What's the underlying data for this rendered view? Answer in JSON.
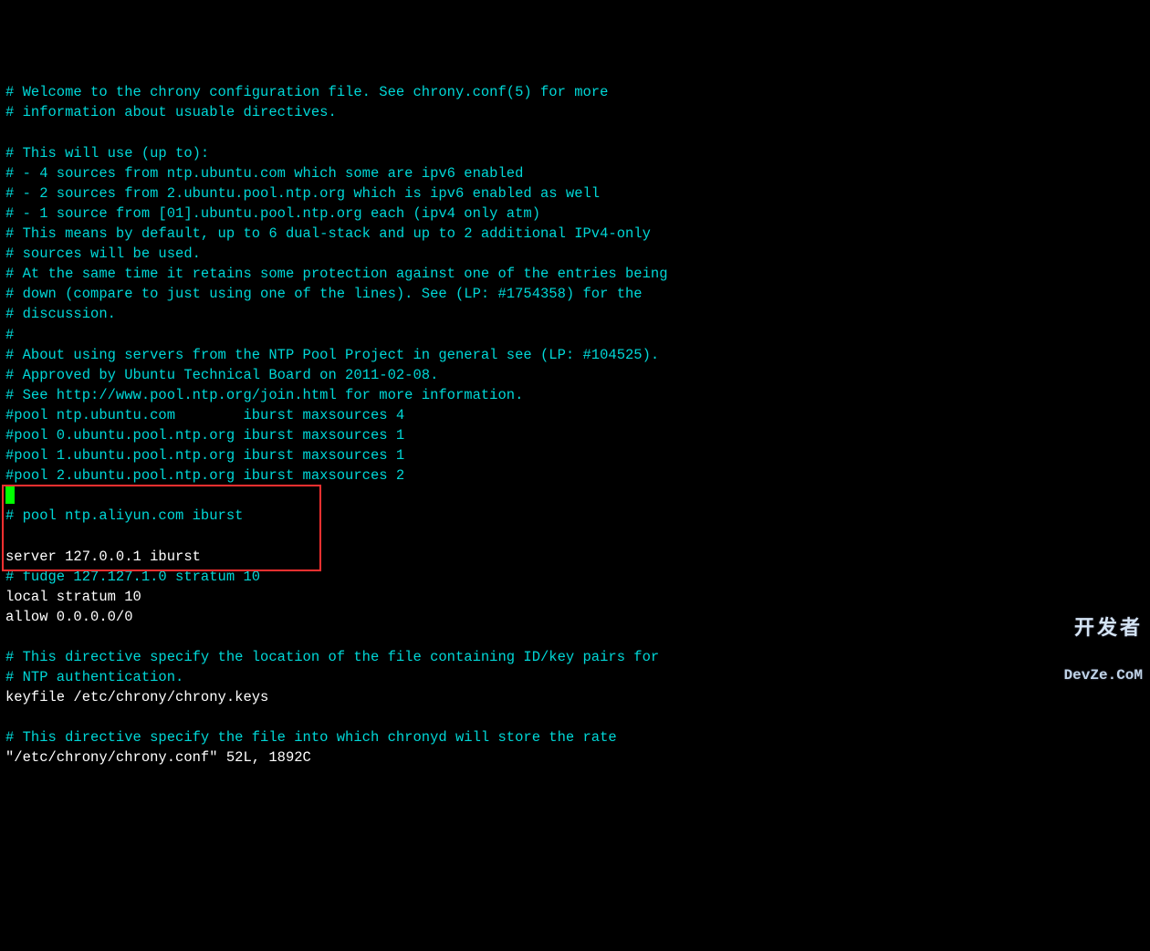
{
  "lines": [
    {
      "text": "# Welcome to the chrony configuration file. See chrony.conf(5) for more",
      "class": "c-cyan"
    },
    {
      "text": "# information about usuable directives.",
      "class": "c-cyan"
    },
    {
      "text": "",
      "class": "c-white"
    },
    {
      "text": "# This will use (up to):",
      "class": "c-cyan"
    },
    {
      "text": "# - 4 sources from ntp.ubuntu.com which some are ipv6 enabled",
      "class": "c-cyan"
    },
    {
      "text": "# - 2 sources from 2.ubuntu.pool.ntp.org which is ipv6 enabled as well",
      "class": "c-cyan"
    },
    {
      "text": "# - 1 source from [01].ubuntu.pool.ntp.org each (ipv4 only atm)",
      "class": "c-cyan"
    },
    {
      "text": "# This means by default, up to 6 dual-stack and up to 2 additional IPv4-only",
      "class": "c-cyan"
    },
    {
      "text": "# sources will be used.",
      "class": "c-cyan"
    },
    {
      "text": "# At the same time it retains some protection against one of the entries being",
      "class": "c-cyan"
    },
    {
      "text": "# down (compare to just using one of the lines). See (LP: #1754358) for the",
      "class": "c-cyan"
    },
    {
      "text": "# discussion.",
      "class": "c-cyan"
    },
    {
      "text": "#",
      "class": "c-cyan"
    },
    {
      "text": "# About using servers from the NTP Pool Project in general see (LP: #104525).",
      "class": "c-cyan"
    },
    {
      "text": "# Approved by Ubuntu Technical Board on 2011-02-08.",
      "class": "c-cyan"
    },
    {
      "text": "# See http://www.pool.ntp.org/join.html for more information.",
      "class": "c-cyan"
    },
    {
      "text": "#pool ntp.ubuntu.com        iburst maxsources 4",
      "class": "c-cyan"
    },
    {
      "text": "#pool 0.ubuntu.pool.ntp.org iburst maxsources 1",
      "class": "c-cyan"
    },
    {
      "text": "#pool 1.ubuntu.pool.ntp.org iburst maxsources 1",
      "class": "c-cyan"
    },
    {
      "text": "#pool 2.ubuntu.pool.ntp.org iburst maxsources 2",
      "class": "c-cyan"
    },
    {
      "cursor": true
    },
    {
      "text": "# pool ntp.aliyun.com iburst",
      "class": "c-cyan"
    },
    {
      "text": "",
      "class": "c-white"
    },
    {
      "text": "server 127.0.0.1 iburst",
      "class": "c-white"
    },
    {
      "text": "# fudge 127.127.1.0 stratum 10",
      "class": "c-cyan"
    },
    {
      "text": "local stratum 10",
      "class": "c-white"
    },
    {
      "text": "allow 0.0.0.0/0",
      "class": "c-white"
    },
    {
      "text": "",
      "class": "c-white"
    },
    {
      "text": "# This directive specify the location of the file containing ID/key pairs for",
      "class": "c-cyan"
    },
    {
      "text": "# NTP authentication.",
      "class": "c-cyan"
    },
    {
      "text": "keyfile /etc/chrony/chrony.keys",
      "class": "c-white"
    },
    {
      "text": "",
      "class": "c-white"
    },
    {
      "text": "# This directive specify the file into which chronyd will store the rate",
      "class": "c-cyan"
    },
    {
      "text": "\"/etc/chrony/chrony.conf\" 52L, 1892C",
      "class": "c-white"
    }
  ],
  "watermark": {
    "line1": "开发者",
    "line2": "DevZe.CoM"
  }
}
